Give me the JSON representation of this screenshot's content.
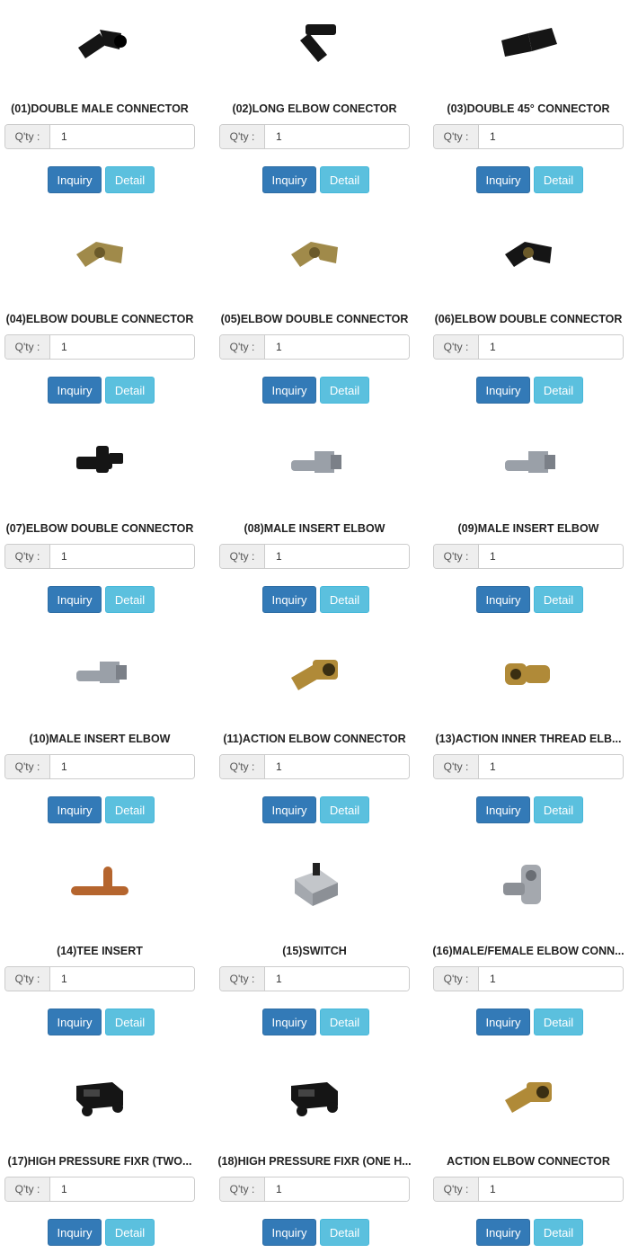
{
  "products": [
    {
      "title": "(01)DOUBLE MALE CONNECTOR",
      "qty_label": "Q'ty :",
      "qty_value": "1",
      "inquiry_label": "Inquiry",
      "detail_label": "Detail",
      "icon": "double-male-connector-icon",
      "color": "#151515"
    },
    {
      "title": "(02)LONG ELBOW CONECTOR",
      "qty_label": "Q'ty :",
      "qty_value": "1",
      "inquiry_label": "Inquiry",
      "detail_label": "Detail",
      "icon": "long-elbow-connector-icon",
      "color": "#151515"
    },
    {
      "title": "(03)DOUBLE 45° CONNECTOR",
      "qty_label": "Q'ty :",
      "qty_value": "1",
      "inquiry_label": "Inquiry",
      "detail_label": "Detail",
      "icon": "double-45-connector-icon",
      "color": "#151515"
    },
    {
      "title": "(04)ELBOW DOUBLE CONNECTOR",
      "qty_label": "Q'ty :",
      "qty_value": "1",
      "inquiry_label": "Inquiry",
      "detail_label": "Detail",
      "icon": "elbow-double-connector-icon",
      "color": "#a08a4a"
    },
    {
      "title": "(05)ELBOW DOUBLE CONNECTOR",
      "qty_label": "Q'ty :",
      "qty_value": "1",
      "inquiry_label": "Inquiry",
      "detail_label": "Detail",
      "icon": "elbow-double-connector-icon",
      "color": "#a08a4a"
    },
    {
      "title": "(06)ELBOW DOUBLE CONNECTOR",
      "qty_label": "Q'ty :",
      "qty_value": "1",
      "inquiry_label": "Inquiry",
      "detail_label": "Detail",
      "icon": "elbow-double-connector-icon",
      "color": "#151515"
    },
    {
      "title": "(07)ELBOW DOUBLE CONNECTOR",
      "qty_label": "Q'ty :",
      "qty_value": "1",
      "inquiry_label": "Inquiry",
      "detail_label": "Detail",
      "icon": "tee-connector-icon",
      "color": "#151515"
    },
    {
      "title": "(08)MALE INSERT ELBOW",
      "qty_label": "Q'ty :",
      "qty_value": "1",
      "inquiry_label": "Inquiry",
      "detail_label": "Detail",
      "icon": "male-insert-elbow-icon",
      "color": "#9aa0a8"
    },
    {
      "title": "(09)MALE INSERT ELBOW",
      "qty_label": "Q'ty :",
      "qty_value": "1",
      "inquiry_label": "Inquiry",
      "detail_label": "Detail",
      "icon": "male-insert-elbow-icon",
      "color": "#9aa0a8"
    },
    {
      "title": "(10)MALE INSERT ELBOW",
      "qty_label": "Q'ty :",
      "qty_value": "1",
      "inquiry_label": "Inquiry",
      "detail_label": "Detail",
      "icon": "male-insert-elbow-icon",
      "color": "#9aa0a8"
    },
    {
      "title": "(11)ACTION ELBOW CONNECTOR",
      "qty_label": "Q'ty :",
      "qty_value": "1",
      "inquiry_label": "Inquiry",
      "detail_label": "Detail",
      "icon": "action-elbow-connector-icon",
      "color": "#b08a38"
    },
    {
      "title": "(13)ACTION INNER THREAD ELB...",
      "qty_label": "Q'ty :",
      "qty_value": "1",
      "inquiry_label": "Inquiry",
      "detail_label": "Detail",
      "icon": "action-inner-thread-elbow-icon",
      "color": "#b08a38"
    },
    {
      "title": "(14)TEE INSERT",
      "qty_label": "Q'ty :",
      "qty_value": "1",
      "inquiry_label": "Inquiry",
      "detail_label": "Detail",
      "icon": "tee-insert-icon",
      "color": "#b5652e"
    },
    {
      "title": "(15)SWITCH",
      "qty_label": "Q'ty :",
      "qty_value": "1",
      "inquiry_label": "Inquiry",
      "detail_label": "Detail",
      "icon": "switch-icon",
      "color": "#a4a8ae"
    },
    {
      "title": "(16)MALE/FEMALE ELBOW CONN...",
      "qty_label": "Q'ty :",
      "qty_value": "1",
      "inquiry_label": "Inquiry",
      "detail_label": "Detail",
      "icon": "male-female-elbow-icon",
      "color": "#a4a8ae"
    },
    {
      "title": "(17)HIGH PRESSURE FIXR (TWO...",
      "qty_label": "Q'ty :",
      "qty_value": "1",
      "inquiry_label": "Inquiry",
      "detail_label": "Detail",
      "icon": "high-pressure-fixer-icon",
      "color": "#151515"
    },
    {
      "title": "(18)HIGH PRESSURE FIXR (ONE H...",
      "qty_label": "Q'ty :",
      "qty_value": "1",
      "inquiry_label": "Inquiry",
      "detail_label": "Detail",
      "icon": "high-pressure-fixer-icon",
      "color": "#151515"
    },
    {
      "title": "ACTION ELBOW CONNECTOR",
      "qty_label": "Q'ty :",
      "qty_value": "1",
      "inquiry_label": "Inquiry",
      "detail_label": "Detail",
      "icon": "action-elbow-connector-icon",
      "color": "#b08a38"
    }
  ],
  "theme": {
    "inquiry_color": "#337ab7",
    "detail_color": "#5bc0de"
  }
}
